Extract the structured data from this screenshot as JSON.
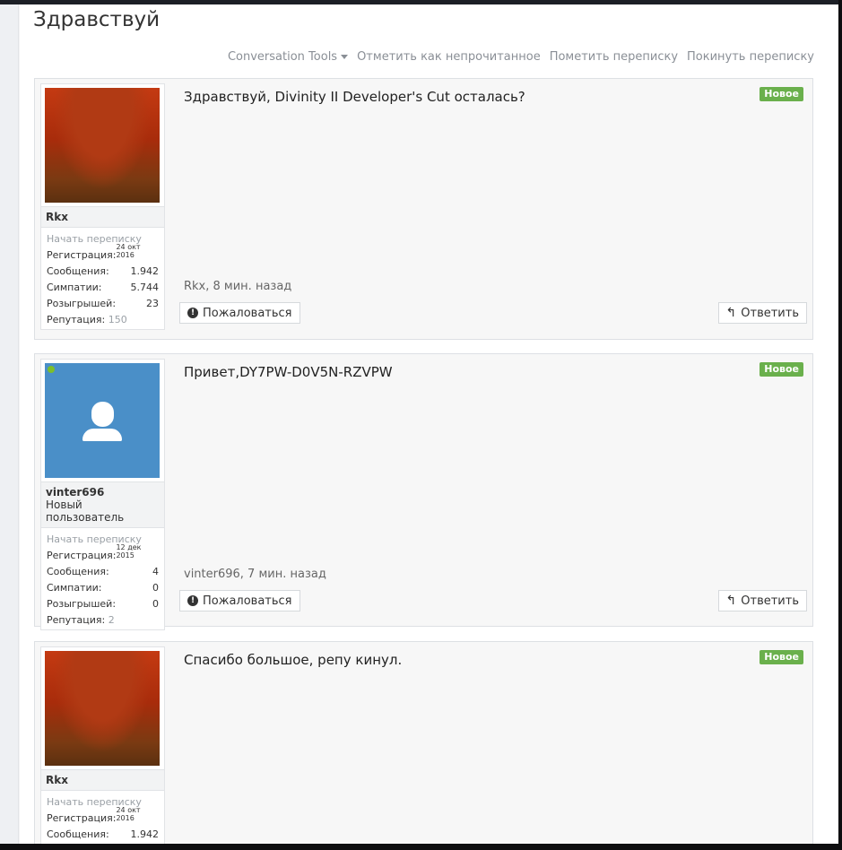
{
  "title": "Здравствуй",
  "tools": {
    "conversation_tools": "Conversation Tools",
    "mark_unread": "Отметить как непрочитанное",
    "flag": "Пометить переписку",
    "leave": "Покинуть переписку"
  },
  "messages": [
    {
      "user": {
        "name": "Rkx",
        "title": "",
        "start_conv": "Начать переписку",
        "reg_label": "Регистрация:",
        "reg_value": "24 окт 2016",
        "posts_label": "Сообщения:",
        "posts_value": "1.942",
        "likes_label": "Симпатии:",
        "likes_value": "5.744",
        "giveaways_label": "Розыгрышей:",
        "giveaways_value": "23",
        "rep_label": "Репутация:",
        "rep_value": "150"
      },
      "text": "Здравствуй, Divinity II Developer's Cut осталась?",
      "badge": "Новое",
      "meta": "Rkx, 8 мин. назад",
      "report": "Пожаловаться",
      "reply": "Ответить"
    },
    {
      "user": {
        "name": "vinter696",
        "title": "Новый пользователь",
        "start_conv": "Начать переписку",
        "reg_label": "Регистрация:",
        "reg_value": "12 дек 2015",
        "posts_label": "Сообщения:",
        "posts_value": "4",
        "likes_label": "Симпатии:",
        "likes_value": "0",
        "giveaways_label": "Розыгрышей:",
        "giveaways_value": "0",
        "rep_label": "Репутация:",
        "rep_value": "2"
      },
      "text": "Привет,DY7PW-D0V5N-RZVPW",
      "badge": "Новое",
      "meta": "vinter696, 7 мин. назад",
      "report": "Пожаловаться",
      "reply": "Ответить"
    },
    {
      "user": {
        "name": "Rkx",
        "title": "",
        "start_conv": "Начать переписку",
        "reg_label": "Регистрация:",
        "reg_value": "24 окт 2016",
        "posts_label": "Сообщения:",
        "posts_value": "1.942"
      },
      "text": "Спасибо большое, репу кинул.",
      "badge": "Новое"
    }
  ]
}
